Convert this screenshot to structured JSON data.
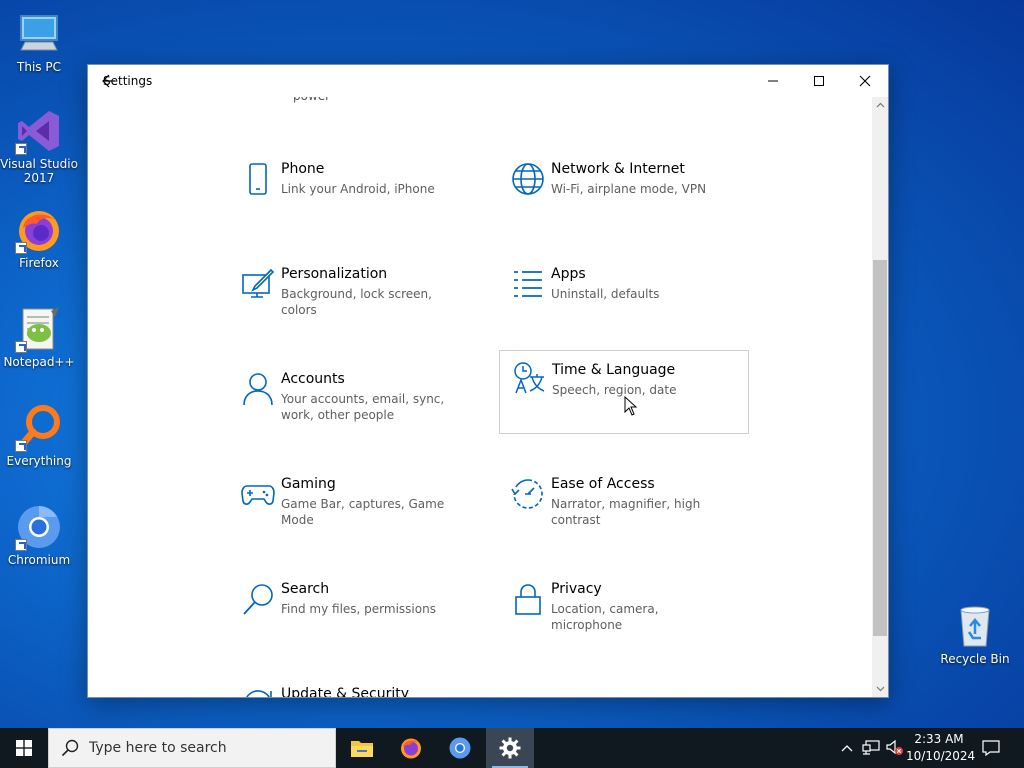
{
  "desktop": {
    "icons": [
      {
        "label": "This PC"
      },
      {
        "label": "Visual Studio 2017"
      },
      {
        "label": "Firefox"
      },
      {
        "label": "Notepad++"
      },
      {
        "label": "Everything"
      },
      {
        "label": "Chromium"
      },
      {
        "label": "Recycle Bin"
      }
    ]
  },
  "window": {
    "title": "Settings",
    "partial_top_text": "power",
    "tiles": [
      {
        "name": "Phone",
        "desc": "Link your Android, iPhone",
        "icon": "phone-icon"
      },
      {
        "name": "Network & Internet",
        "desc": "Wi-Fi, airplane mode, VPN",
        "icon": "globe-icon"
      },
      {
        "name": "Personalization",
        "desc": "Background, lock screen, colors",
        "icon": "paintbrush-icon"
      },
      {
        "name": "Apps",
        "desc": "Uninstall, defaults",
        "icon": "apps-list-icon"
      },
      {
        "name": "Accounts",
        "desc": "Your accounts, email, sync, work, other people",
        "icon": "person-icon"
      },
      {
        "name": "Time & Language",
        "desc": "Speech, region, date",
        "icon": "time-language-icon"
      },
      {
        "name": "Gaming",
        "desc": "Game Bar, captures, Game Mode",
        "icon": "gamepad-icon"
      },
      {
        "name": "Ease of Access",
        "desc": "Narrator, magnifier, high contrast",
        "icon": "ease-of-access-icon"
      },
      {
        "name": "Search",
        "desc": "Find my files, permissions",
        "icon": "search-icon"
      },
      {
        "name": "Privacy",
        "desc": "Location, camera, microphone",
        "icon": "lock-icon"
      },
      {
        "name": "Update & Security",
        "desc": "",
        "icon": "update-icon"
      }
    ]
  },
  "taskbar": {
    "search_placeholder": "Type here to search",
    "clock_time": "2:33 AM",
    "clock_date": "10/10/2024"
  },
  "colors": {
    "accent": "#0067c0",
    "taskbar": "#101820"
  }
}
